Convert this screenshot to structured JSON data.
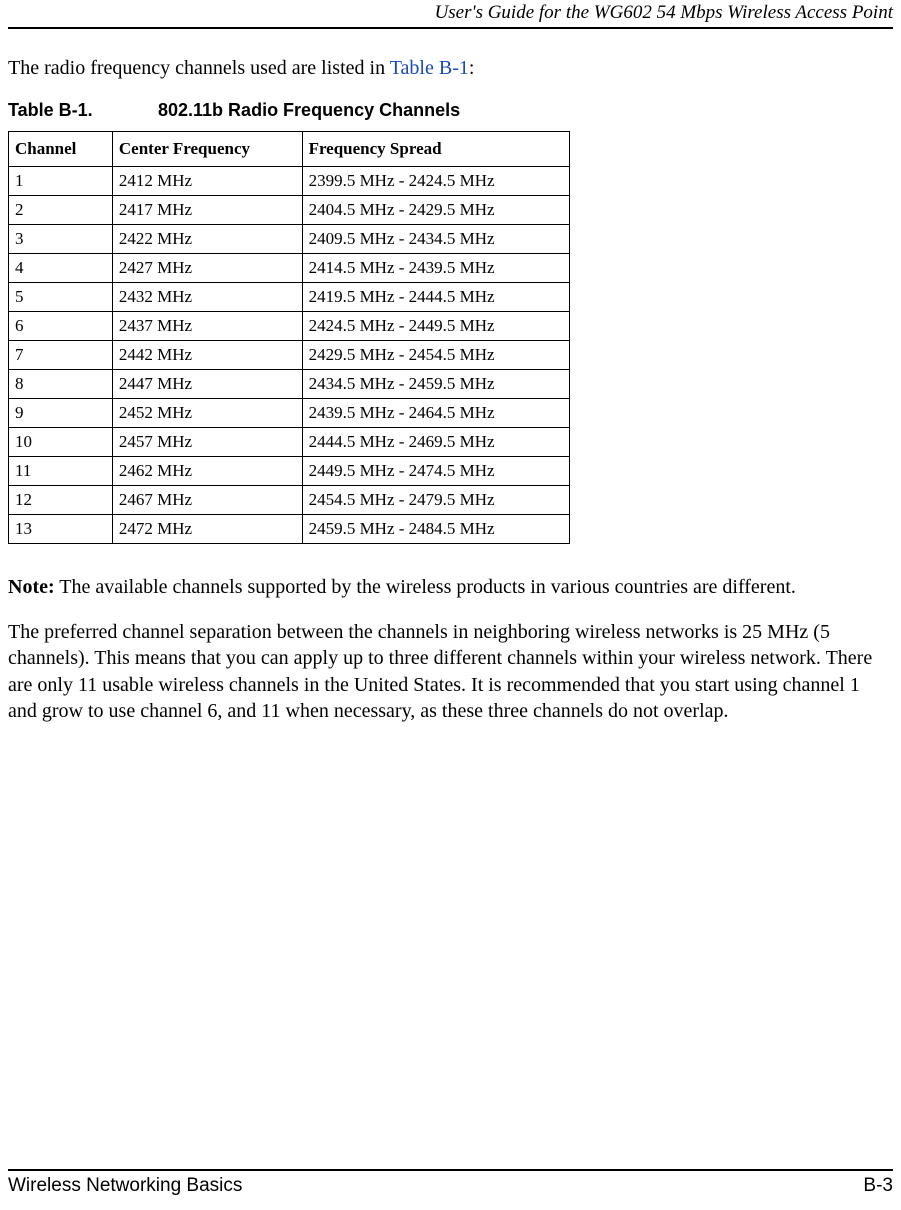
{
  "header": {
    "title": "User's Guide for the WG602 54 Mbps Wireless Access Point"
  },
  "intro": {
    "prefix": "The radio frequency channels used are listed in ",
    "link": "Table B-1",
    "suffix": ":"
  },
  "caption": {
    "label": "Table B-1.",
    "title": "802.11b Radio Frequency Channels"
  },
  "chart_data": {
    "type": "table",
    "columns": [
      "Channel",
      "Center Frequency",
      "Frequency Spread"
    ],
    "rows": [
      [
        "1",
        "2412 MHz",
        "2399.5 MHz - 2424.5 MHz"
      ],
      [
        "2",
        "2417 MHz",
        "2404.5 MHz - 2429.5 MHz"
      ],
      [
        "3",
        "2422 MHz",
        "2409.5 MHz - 2434.5 MHz"
      ],
      [
        "4",
        "2427 MHz",
        "2414.5 MHz - 2439.5 MHz"
      ],
      [
        "5",
        "2432 MHz",
        "2419.5 MHz - 2444.5 MHz"
      ],
      [
        "6",
        "2437 MHz",
        "2424.5 MHz - 2449.5 MHz"
      ],
      [
        "7",
        "2442 MHz",
        "2429.5 MHz - 2454.5 MHz"
      ],
      [
        "8",
        "2447 MHz",
        "2434.5 MHz - 2459.5 MHz"
      ],
      [
        "9",
        "2452 MHz",
        "2439.5 MHz - 2464.5 MHz"
      ],
      [
        "10",
        "2457 MHz",
        "2444.5 MHz - 2469.5 MHz"
      ],
      [
        "11",
        "2462 MHz",
        "2449.5 MHz - 2474.5 MHz"
      ],
      [
        "12",
        "2467 MHz",
        "2454.5 MHz - 2479.5 MHz"
      ],
      [
        "13",
        "2472 MHz",
        "2459.5 MHz - 2484.5 MHz"
      ]
    ]
  },
  "note": {
    "label": "Note:",
    "text": " The available channels supported by the wireless products in various countries are different."
  },
  "body": {
    "para1": "The preferred channel separation between the channels in neighboring wireless networks is 25 MHz (5 channels). This means that you can apply up to three different channels within your wireless network. There are only 11 usable wireless channels in the United States. It is recommended that you start using channel 1 and grow to use channel 6, and 11 when necessary, as these three channels do not overlap."
  },
  "footer": {
    "section": "Wireless Networking Basics",
    "page": "B-3"
  }
}
